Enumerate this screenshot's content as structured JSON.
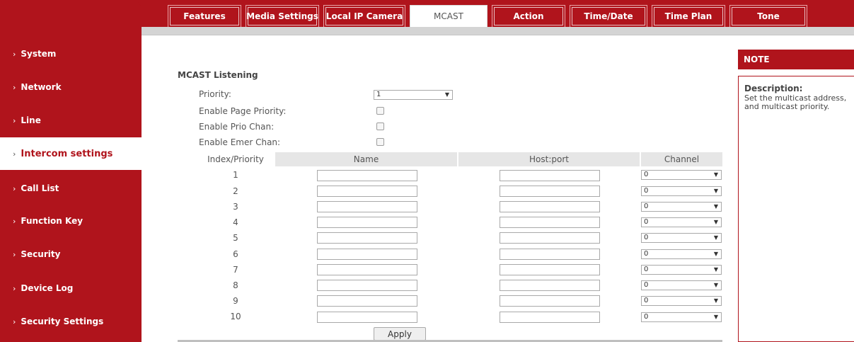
{
  "tabs": [
    {
      "label": "Features",
      "active": false
    },
    {
      "label": "Media Settings",
      "active": false
    },
    {
      "label": "Local IP Camera",
      "active": false
    },
    {
      "label": "MCAST",
      "active": true
    },
    {
      "label": "Action",
      "active": false
    },
    {
      "label": "Time/Date",
      "active": false
    },
    {
      "label": "Time Plan",
      "active": false
    },
    {
      "label": "Tone",
      "active": false
    }
  ],
  "sidebar": {
    "items": [
      {
        "label": "System",
        "active": false
      },
      {
        "label": "Network",
        "active": false
      },
      {
        "label": "Line",
        "active": false
      },
      {
        "label": "Intercom settings",
        "active": true
      },
      {
        "label": "Call List",
        "active": false
      },
      {
        "label": "Function Key",
        "active": false
      },
      {
        "label": "Security",
        "active": false
      },
      {
        "label": "Device Log",
        "active": false
      },
      {
        "label": "Security Settings",
        "active": false
      }
    ],
    "chevron": "›"
  },
  "section": {
    "title": "MCAST Listening",
    "priority_label": "Priority:",
    "priority_value": "1",
    "enable_page_priority_label": "Enable Page Priority:",
    "enable_prio_chan_label": "Enable Prio Chan:",
    "enable_emer_chan_label": "Enable Emer Chan:"
  },
  "table": {
    "headers": {
      "index": "Index/Priority",
      "name": "Name",
      "host": "Host:port",
      "channel": "Channel"
    },
    "rows": [
      {
        "index": "1",
        "name": "",
        "host": "",
        "channel": "0"
      },
      {
        "index": "2",
        "name": "",
        "host": "",
        "channel": "0"
      },
      {
        "index": "3",
        "name": "",
        "host": "",
        "channel": "0"
      },
      {
        "index": "4",
        "name": "",
        "host": "",
        "channel": "0"
      },
      {
        "index": "5",
        "name": "",
        "host": "",
        "channel": "0"
      },
      {
        "index": "6",
        "name": "",
        "host": "",
        "channel": "0"
      },
      {
        "index": "7",
        "name": "",
        "host": "",
        "channel": "0"
      },
      {
        "index": "8",
        "name": "",
        "host": "",
        "channel": "0"
      },
      {
        "index": "9",
        "name": "",
        "host": "",
        "channel": "0"
      },
      {
        "index": "10",
        "name": "",
        "host": "",
        "channel": "0"
      }
    ]
  },
  "apply_label": "Apply",
  "note": {
    "header": "NOTE",
    "title": "Description:",
    "text": "Set the multicast address, and multicast priority."
  },
  "icons": {
    "dropdown": "▼"
  },
  "colors": {
    "brand_red": "#b0141c",
    "header_gray": "#e6e6e6"
  }
}
